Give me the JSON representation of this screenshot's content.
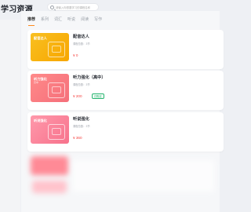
{
  "page": {
    "title": "学习资源"
  },
  "search": {
    "placeholder": "请输入你想要学习的课程名称"
  },
  "tabs": [
    {
      "label": "推荐",
      "active": true
    },
    {
      "label": "系列",
      "active": false
    },
    {
      "label": "词汇",
      "active": false
    },
    {
      "label": "听说",
      "active": false
    },
    {
      "label": "阅读",
      "active": false
    },
    {
      "label": "写作",
      "active": false
    }
  ],
  "courses": [
    {
      "cover_label": "配音达人",
      "cover_sub": "",
      "title": "配音达人",
      "meta": "课程总数：3节",
      "price": "¥ 0",
      "badge": "",
      "cover_color": "#f9c021"
    },
    {
      "cover_label": "听力强化",
      "cover_sub": "高中",
      "title": "听力强化（高中）",
      "meta": "课程总数：3节",
      "price": "¥ 200",
      "badge": "已购买",
      "cover_color": "#ff8a8a"
    },
    {
      "cover_label": "听说强化",
      "cover_sub": "",
      "title": "听说强化",
      "meta": "课程总数：3节",
      "price": "¥ 360",
      "badge": "",
      "cover_color": "#ff99ab"
    }
  ],
  "colors": {
    "accent": "#ff8a1d",
    "price": "#f5413f",
    "badge": "#2bb673"
  }
}
